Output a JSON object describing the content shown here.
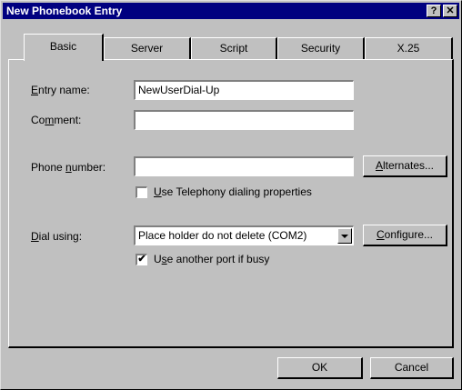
{
  "window": {
    "title": "New Phonebook Entry",
    "help_glyph": "?",
    "close_glyph": "✕"
  },
  "tabs": [
    {
      "label": "Basic",
      "active": true
    },
    {
      "label": "Server",
      "active": false
    },
    {
      "label": "Script",
      "active": false
    },
    {
      "label": "Security",
      "active": false
    },
    {
      "label": "X.25",
      "active": false
    }
  ],
  "form": {
    "entry_name": {
      "label_pre": "",
      "label_u": "E",
      "label_post": "ntry name:",
      "value": "NewUserDial-Up"
    },
    "comment": {
      "label_pre": "Co",
      "label_u": "m",
      "label_post": "ment:",
      "value": ""
    },
    "phone_number": {
      "label_pre": "Phone ",
      "label_u": "n",
      "label_post": "umber:",
      "value": ""
    },
    "alternates_button": {
      "pre": "",
      "u": "A",
      "post": "lternates..."
    },
    "telephony_checkbox": {
      "pre": "",
      "u": "U",
      "post": "se Telephony dialing properties",
      "checked": false
    },
    "dial_using": {
      "label_pre": "",
      "label_u": "D",
      "label_post": "ial using:",
      "value": "Place holder do not delete (COM2)"
    },
    "configure_button": {
      "pre": "",
      "u": "C",
      "post": "onfigure..."
    },
    "another_port_checkbox": {
      "pre": "U",
      "u": "s",
      "post": "e another port if busy",
      "checked": true
    }
  },
  "footer": {
    "ok_label": "OK",
    "cancel_label": "Cancel"
  },
  "icons": {
    "check_mark": "✔"
  }
}
